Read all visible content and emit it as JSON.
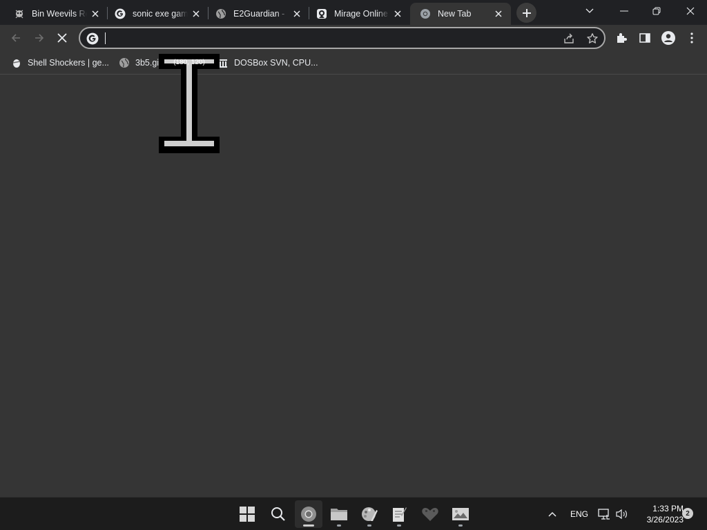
{
  "tabs": [
    {
      "title": "Bin Weevils Re",
      "icon": "bin-weevils-icon",
      "active": false
    },
    {
      "title": "sonic exe gam",
      "icon": "google-icon",
      "active": false
    },
    {
      "title": "E2Guardian -",
      "icon": "globe-icon",
      "active": false
    },
    {
      "title": "Mirage Online",
      "icon": "mirage-icon",
      "active": false
    },
    {
      "title": "New Tab",
      "icon": "chrome-icon",
      "active": true
    }
  ],
  "toolbar": {
    "omnibox_value": "",
    "omnibox_icon": "google-icon"
  },
  "bookmarks": [
    {
      "label": "Shell Shockers | ge...",
      "icon": "egg-icon"
    },
    {
      "label": "3b5.gi",
      "icon": "globe-icon"
    },
    {
      "label": "DOSBox SVN, CPU...",
      "icon": "archive-icon"
    }
  ],
  "cursor_tooltip": "(180, 120)",
  "taskbar": {
    "apps": [
      "start-icon",
      "search-icon",
      "chrome-icon",
      "file-explorer-icon",
      "paint-icon",
      "notepad-icon",
      "heart-icon",
      "photos-icon"
    ],
    "language": "ENG",
    "time": "1:33 PM",
    "date": "3/26/2023",
    "notification_count": "2"
  },
  "colors": {
    "tab_strip": "#202124",
    "toolbar": "#353535",
    "content": "#353535",
    "taskbar": "#1c1c1c"
  }
}
